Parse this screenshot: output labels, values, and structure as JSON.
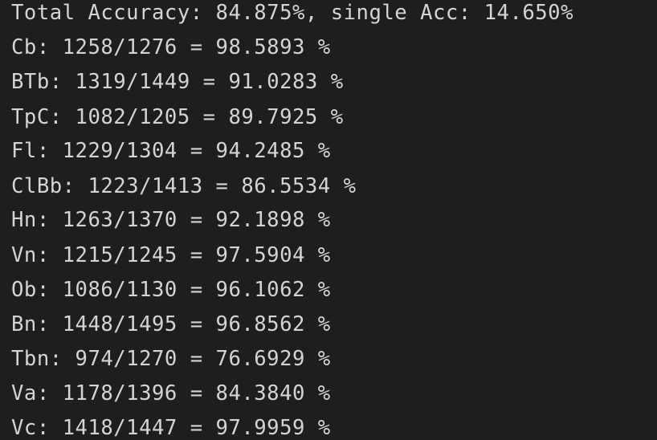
{
  "terminal": {
    "lines": [
      "Total Accuracy: 84.875%, single Acc: 14.650%",
      "Cb: 1258/1276 = 98.5893 %",
      "BTb: 1319/1449 = 91.0283 %",
      "TpC: 1082/1205 = 89.7925 %",
      "Fl: 1229/1304 = 94.2485 %",
      "ClBb: 1223/1413 = 86.5534 %",
      "Hn: 1263/1370 = 92.1898 %",
      "Vn: 1215/1245 = 97.5904 %",
      "Ob: 1086/1130 = 96.1062 %",
      "Bn: 1448/1495 = 96.8562 %",
      "Tbn: 974/1270 = 76.6929 %",
      "Va: 1178/1396 = 84.3840 %",
      "Vc: 1418/1447 = 97.9959 %"
    ]
  }
}
